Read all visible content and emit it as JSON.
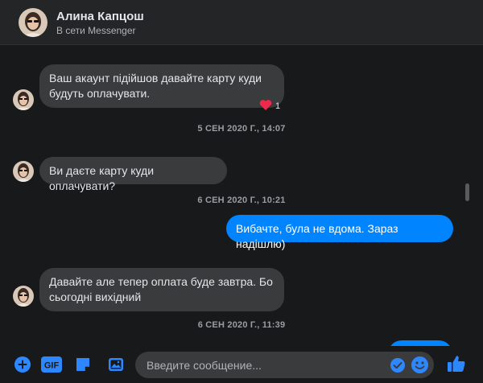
{
  "contact": {
    "name": "Алина Капцош",
    "status": "В сети Messenger"
  },
  "messages": [
    {
      "text_lines": [
        "Ваш акаунт підійшов давайте карту куди",
        "будуть оплачувати."
      ],
      "reaction_count": "1"
    },
    {
      "text": "Ви даєте карту куди оплачувати?"
    },
    {
      "text": "Вибачте, була не вдома. Зараз надішлю)"
    },
    {
      "text_lines": [
        "Давайте але тепер оплата буде завтра. Бо",
        "сьогодні вихідний"
      ]
    }
  ],
  "timestamps": [
    "5 СЕН 2020 Г., 14:07",
    "6 СЕН 2020 Г., 10:21",
    "6 СЕН 2020 Г., 11:39"
  ],
  "composer": {
    "placeholder": "Введите сообщение...",
    "gif_label": "GIF"
  },
  "colors": {
    "accent": "#0084ff",
    "background": "#18191a",
    "header": "#242526",
    "bubble_incoming": "#3a3b3c",
    "reaction_heart": "#f02849"
  },
  "icons": [
    "plus-icon",
    "gif-icon",
    "sticker-icon",
    "image-icon",
    "send-check-icon",
    "emoji-icon",
    "like-icon",
    "heart-icon"
  ]
}
